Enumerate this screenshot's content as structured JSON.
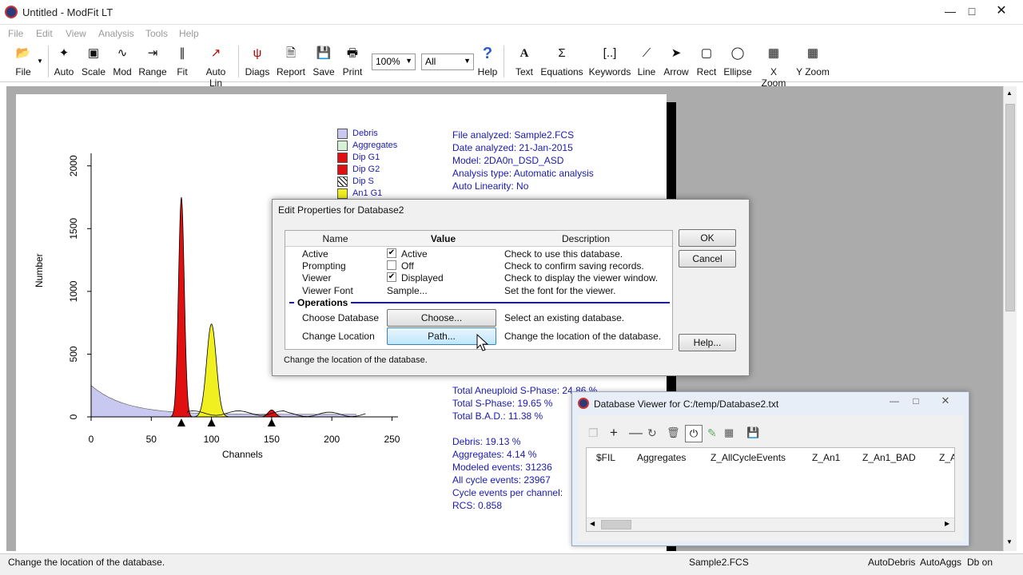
{
  "app": {
    "title": "Untitled - ModFit LT"
  },
  "menu": [
    "File",
    "Edit",
    "View",
    "Analysis",
    "Tools",
    "Help"
  ],
  "toolbar": {
    "left": [
      {
        "label": "File",
        "icon": "open-folder-icon"
      },
      {
        "label": "Auto",
        "icon": "wand-icon"
      },
      {
        "label": "Scale",
        "icon": "scale-icon"
      },
      {
        "label": "Mod",
        "icon": "model-icon"
      },
      {
        "label": "Range",
        "icon": "range-icon"
      },
      {
        "label": "Fit",
        "icon": "fit-icon"
      },
      {
        "label": "Auto Lin",
        "icon": "autolin-icon"
      },
      {
        "label": "Diags",
        "icon": "diags-icon"
      },
      {
        "label": "Report",
        "icon": "report-icon"
      },
      {
        "label": "Save",
        "icon": "save-icon"
      },
      {
        "label": "Print",
        "icon": "print-icon"
      }
    ],
    "zoom": "100%",
    "filter": "All",
    "help": "Help",
    "right": [
      {
        "label": "Text",
        "icon": "text-icon"
      },
      {
        "label": "Equations",
        "icon": "sigma-icon"
      },
      {
        "label": "Keywords",
        "icon": "keywords-icon"
      },
      {
        "label": "Line",
        "icon": "line-icon"
      },
      {
        "label": "Arrow",
        "icon": "arrow-icon"
      },
      {
        "label": "Rect",
        "icon": "rect-icon"
      },
      {
        "label": "Ellipse",
        "icon": "ellipse-icon"
      },
      {
        "label": "X Zoom",
        "icon": "xzoom-icon"
      },
      {
        "label": "Y Zoom",
        "icon": "yzoom-icon"
      }
    ]
  },
  "legend": [
    {
      "label": "Debris",
      "color": "#c8c8f0"
    },
    {
      "label": "Aggregates",
      "color": "#d8f0d8"
    },
    {
      "label": "Dip G1",
      "color": "#e01010"
    },
    {
      "label": "Dip G2",
      "color": "#e01010"
    },
    {
      "label": "Dip S",
      "color": "hatched"
    },
    {
      "label": "An1 G1",
      "color": "#f0f020"
    }
  ],
  "report_header": [
    "File analyzed: Sample2.FCS",
    "Date analyzed: 21-Jan-2015",
    "Model: 2DA0n_DSD_ASD",
    "Analysis type: Automatic analysis",
    "Auto Linearity: No"
  ],
  "report_stats": [
    "Total Aneuploid S-Phase: 24.86 %",
    "Total S-Phase: 19.65 %",
    "Total B.A.D.: 11.38 %",
    "",
    "Debris: 19.13 %",
    "Aggregates: 4.14 %",
    "Modeled events: 31236",
    "All cycle events: 23967",
    "Cycle events per channel:",
    "RCS: 0.858"
  ],
  "histogram": {
    "xlabel": "Channels",
    "ylabel": "Number",
    "x_ticks": [
      "0",
      "50",
      "100",
      "150",
      "200",
      "250"
    ],
    "y_ticks": [
      "0",
      "500",
      "1000",
      "1500",
      "2000"
    ],
    "xlim": [
      0,
      255
    ],
    "ylim": [
      0,
      2100
    ],
    "peaks": [
      {
        "name": "Dip G1",
        "x": 75,
        "height": 1750,
        "color": "#e01010"
      },
      {
        "name": "An1 G1",
        "x": 100,
        "height": 740,
        "color": "#f0f020"
      },
      {
        "name": "Dip G2",
        "x": 150,
        "height": 55,
        "color": "#e01010"
      }
    ]
  },
  "dialog": {
    "title": "Edit Properties for Database2",
    "columns": [
      "Name",
      "Value",
      "Description"
    ],
    "rows": [
      {
        "name": "Active",
        "checked": true,
        "value": "Active",
        "desc": "Check to use this database."
      },
      {
        "name": "Prompting",
        "checked": false,
        "value": "Off",
        "desc": "Check to confirm saving records."
      },
      {
        "name": "Viewer",
        "checked": true,
        "value": "Displayed",
        "desc": "Check to display the viewer window."
      },
      {
        "name": "Viewer Font",
        "value": "Sample...",
        "desc": "Set the font for the viewer."
      }
    ],
    "section": "Operations",
    "ops": [
      {
        "name": "Choose Database",
        "button": "Choose...",
        "desc": "Select an existing database."
      },
      {
        "name": "Change Location",
        "button": "Path...",
        "desc": "Change the location of the database."
      }
    ],
    "hint": "Change the location of the database.",
    "ok": "OK",
    "cancel": "Cancel",
    "help": "Help..."
  },
  "db_viewer": {
    "title": "Database Viewer for C:/temp/Database2.txt",
    "columns": [
      "$FIL",
      "Aggregates",
      "Z_AllCycleEvents",
      "Z_An1",
      "Z_An1_BAD",
      "Z_A"
    ]
  },
  "status": {
    "message": "Change the location of the database.",
    "file": "Sample2.FCS",
    "flags": [
      "AutoDebris",
      "AutoAggs",
      "Db on"
    ]
  }
}
